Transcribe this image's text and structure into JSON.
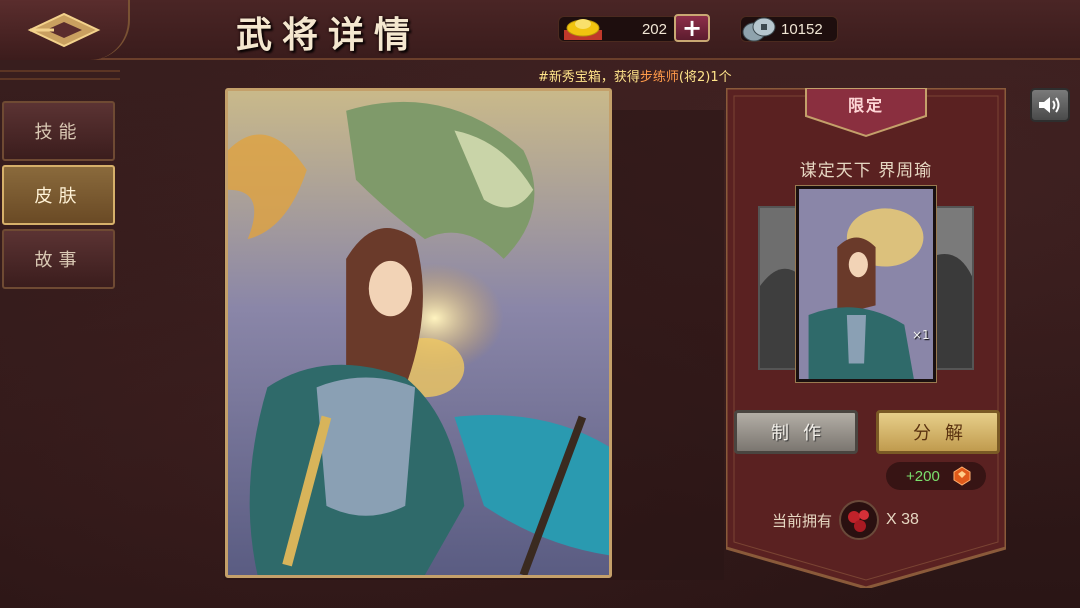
{
  "header": {
    "title": "武将详情",
    "gold_amount": "202",
    "coin_amount": "10152"
  },
  "marquee": {
    "prefix": "#新秀宝箱，获得",
    "highlight": "步练师",
    "suffix": "(将2)1个"
  },
  "tabs": [
    {
      "label": "技能",
      "active": false
    },
    {
      "label": "皮肤",
      "active": true
    },
    {
      "label": "故事",
      "active": false
    }
  ],
  "skin_panel": {
    "badge": "限定",
    "skin_name": "谋定天下  界周瑜",
    "card_count": "×1",
    "make_button": "制作",
    "decompose_button": "分解",
    "reward": "+200",
    "owned_label": "当前拥有",
    "owned_count": "X 38"
  },
  "icons": [
    "back-arrow-icon",
    "gold-ingot-icon",
    "plus-icon",
    "copper-coin-icon",
    "speaker-icon",
    "red-gem-icon"
  ],
  "colors": {
    "background": "#2b1616",
    "accent_gold": "#c4a06a",
    "reward_green": "#7be06d",
    "banner_red": "#6a2424"
  }
}
